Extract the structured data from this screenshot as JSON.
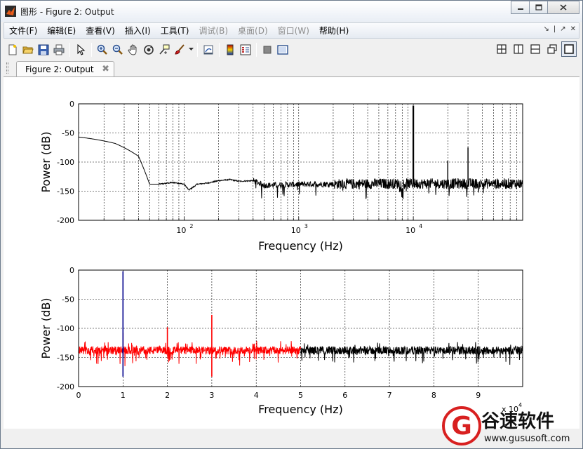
{
  "window": {
    "title": "图形 - Figure 2: Output",
    "buttons": {
      "minimize": "▭",
      "maximize": "▣",
      "close": "✕"
    }
  },
  "menu": {
    "items": [
      {
        "label": "文件(F)",
        "enabled": true
      },
      {
        "label": "编辑(E)",
        "enabled": true
      },
      {
        "label": "查看(V)",
        "enabled": true
      },
      {
        "label": "插入(I)",
        "enabled": true
      },
      {
        "label": "工具(T)",
        "enabled": true
      },
      {
        "label": "调试(B)",
        "enabled": false
      },
      {
        "label": "桌面(D)",
        "enabled": false
      },
      {
        "label": "窗口(W)",
        "enabled": false
      },
      {
        "label": "帮助(H)",
        "enabled": true
      }
    ],
    "right_glyphs": [
      "↘",
      "|",
      "↗",
      "✕"
    ]
  },
  "toolbar": {
    "icons": [
      "new-figure-icon",
      "open-file-icon",
      "save-icon",
      "print-icon",
      "pointer-icon",
      "zoom-in-icon",
      "zoom-out-icon",
      "pan-hand-icon",
      "rotate-3d-icon",
      "data-cursor-icon",
      "brush-icon",
      "link-plot-icon",
      "colorbar-icon",
      "legend-icon",
      "hide-plot-tools-icon",
      "show-plot-tools-icon"
    ],
    "layout_icons": [
      "tile-icon",
      "split-vertical-icon",
      "split-horizontal-icon",
      "float-icon",
      "maximize-icon"
    ]
  },
  "tab": {
    "label": "Figure 2: Output",
    "close": "✖"
  },
  "colors": {
    "black_series": "#000000",
    "red_series": "#ff0000",
    "blue_series": "#00008b",
    "grid": "#000000"
  },
  "chart_data": [
    {
      "type": "line",
      "title": "",
      "xlabel": "Frequency (Hz)",
      "ylabel": "Power (dB)",
      "xscale": "log",
      "xlim": [
        12,
        90000
      ],
      "ylim": [
        -200,
        0
      ],
      "yticks": [
        0,
        -50,
        -100,
        -150,
        -200
      ],
      "xtick_labels": [
        {
          "value": 100,
          "base": "10",
          "exp": "2"
        },
        {
          "value": 1000,
          "base": "10",
          "exp": "3"
        },
        {
          "value": 10000,
          "base": "10",
          "exp": "4"
        }
      ],
      "grid": true,
      "series": [
        {
          "color": "#000000",
          "envelope": {
            "x": [
              12,
              25,
              40,
              50,
              60,
              80,
              100,
              110,
              130,
              160,
              200,
              250,
              300,
              400,
              500,
              1000,
              5000,
              20000,
              90000
            ],
            "y": [
              -57,
              -68,
              -90,
              -138,
              -138,
              -135,
              -138,
              -148,
              -138,
              -136,
              -132,
              -130,
              -133,
              -132,
              -140,
              -138,
              -137,
              -137,
              -137
            ]
          },
          "spikes": [
            {
              "x": 10000,
              "y": -3
            },
            {
              "x": 20000,
              "y": -98
            },
            {
              "x": 30000,
              "y": -75
            }
          ]
        }
      ]
    },
    {
      "type": "line",
      "title": "",
      "xlabel": "Frequency (Hz)",
      "ylabel": "Power (dB)",
      "xscale": "linear",
      "xlim": [
        0,
        100000
      ],
      "ylim": [
        -200,
        0
      ],
      "xticks": [
        0,
        10000,
        20000,
        30000,
        40000,
        50000,
        60000,
        70000,
        80000,
        90000
      ],
      "xtick_labels": [
        "0",
        "1",
        "2",
        "3",
        "4",
        "5",
        "6",
        "7",
        "8",
        "9"
      ],
      "yticks": [
        0,
        -50,
        -100,
        -150,
        -200
      ],
      "x_multiplier": {
        "base": "x 10",
        "exp": "4"
      },
      "grid": true,
      "series": [
        {
          "color": "#000000",
          "range": [
            50000,
            100000
          ],
          "baseline": -138,
          "spikes": []
        },
        {
          "color": "#ff0000",
          "range": [
            0,
            50000
          ],
          "baseline": -138,
          "spikes": [
            {
              "x": 10000,
              "y": -108
            },
            {
              "x": 20000,
              "y": -98
            },
            {
              "x": 30000,
              "y": -77
            }
          ]
        },
        {
          "color": "#00008b",
          "range": [
            9900,
            10100
          ],
          "baseline": -138,
          "spikes": [
            {
              "x": 10000,
              "y": -2
            }
          ]
        }
      ]
    }
  ],
  "watermark": {
    "glyph": "G",
    "text": "谷速软件",
    "url": "www.gususoft.com"
  }
}
